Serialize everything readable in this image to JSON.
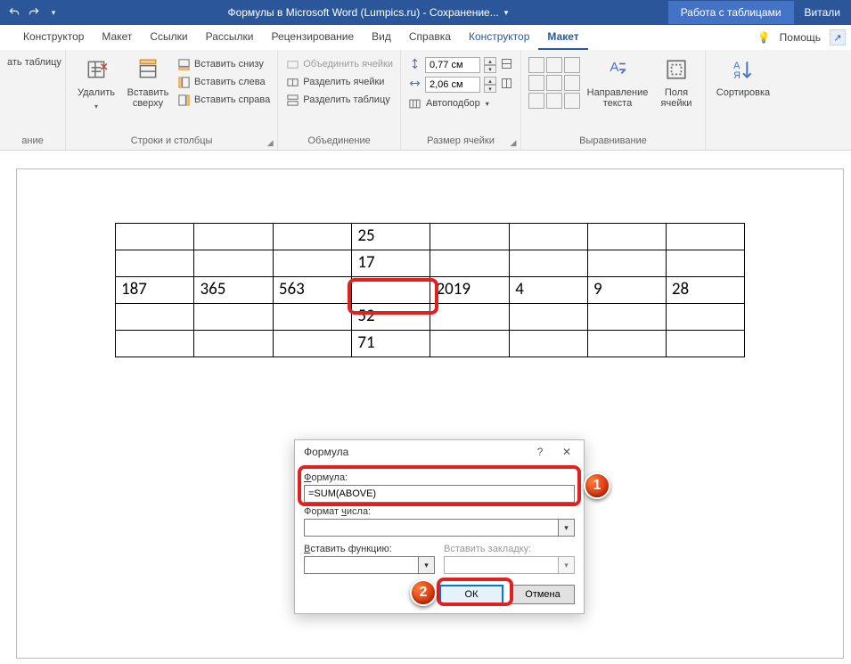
{
  "title_bar": {
    "document_title": "Формулы в Microsoft Word (Lumpics.ru)  -  Сохранение...",
    "table_tools_label": "Работа с таблицами",
    "user_name": "Витали"
  },
  "tabs": {
    "constructor1": "Конструктор",
    "layout": "Макет",
    "references": "Ссылки",
    "mailings": "Рассылки",
    "review": "Рецензирование",
    "view": "Вид",
    "help": "Справка",
    "tt_constructor": "Конструктор",
    "tt_layout": "Макет",
    "tell_me": "Помощь"
  },
  "ribbon": {
    "draw": {
      "draw_table": "ать таблицу",
      "group_label": "ание"
    },
    "rows_cols": {
      "delete": "Удалить",
      "insert_above": "Вставить сверху",
      "insert_below": "Вставить снизу",
      "insert_left": "Вставить слева",
      "insert_right": "Вставить справа",
      "group_label": "Строки и столбцы"
    },
    "merge": {
      "merge_cells": "Объединить ячейки",
      "split_cells": "Разделить ячейки",
      "split_table": "Разделить таблицу",
      "group_label": "Объединение"
    },
    "cell_size": {
      "height": "0,77 см",
      "width": "2,06 см",
      "autofit": "Автоподбор",
      "group_label": "Размер ячейки"
    },
    "alignment": {
      "text_direction": "Направление текста",
      "cell_margins": "Поля ячейки",
      "group_label": "Выравнивание"
    },
    "data_group": {
      "sort": "Сортировка"
    }
  },
  "table_data": {
    "rows": [
      [
        "",
        "",
        "",
        "25",
        "",
        "",
        "",
        ""
      ],
      [
        "",
        "",
        "",
        "17",
        "",
        "",
        "",
        ""
      ],
      [
        "187",
        "365",
        "563",
        "",
        "2019",
        "4",
        "9",
        "28"
      ],
      [
        "",
        "",
        "",
        "52",
        "",
        "",
        "",
        ""
      ],
      [
        "",
        "",
        "",
        "71",
        "",
        "",
        "",
        ""
      ]
    ]
  },
  "dialog": {
    "title": "Формула",
    "formula_label": "Формула:",
    "formula_value": "=SUM(ABOVE)",
    "format_label": "Формат числа:",
    "insert_func_label": "Вставить функцию:",
    "insert_bookmark_label": "Вставить закладку:",
    "ok": "ОК",
    "cancel": "Отмена"
  },
  "markers": {
    "m1": "1",
    "m2": "2"
  }
}
